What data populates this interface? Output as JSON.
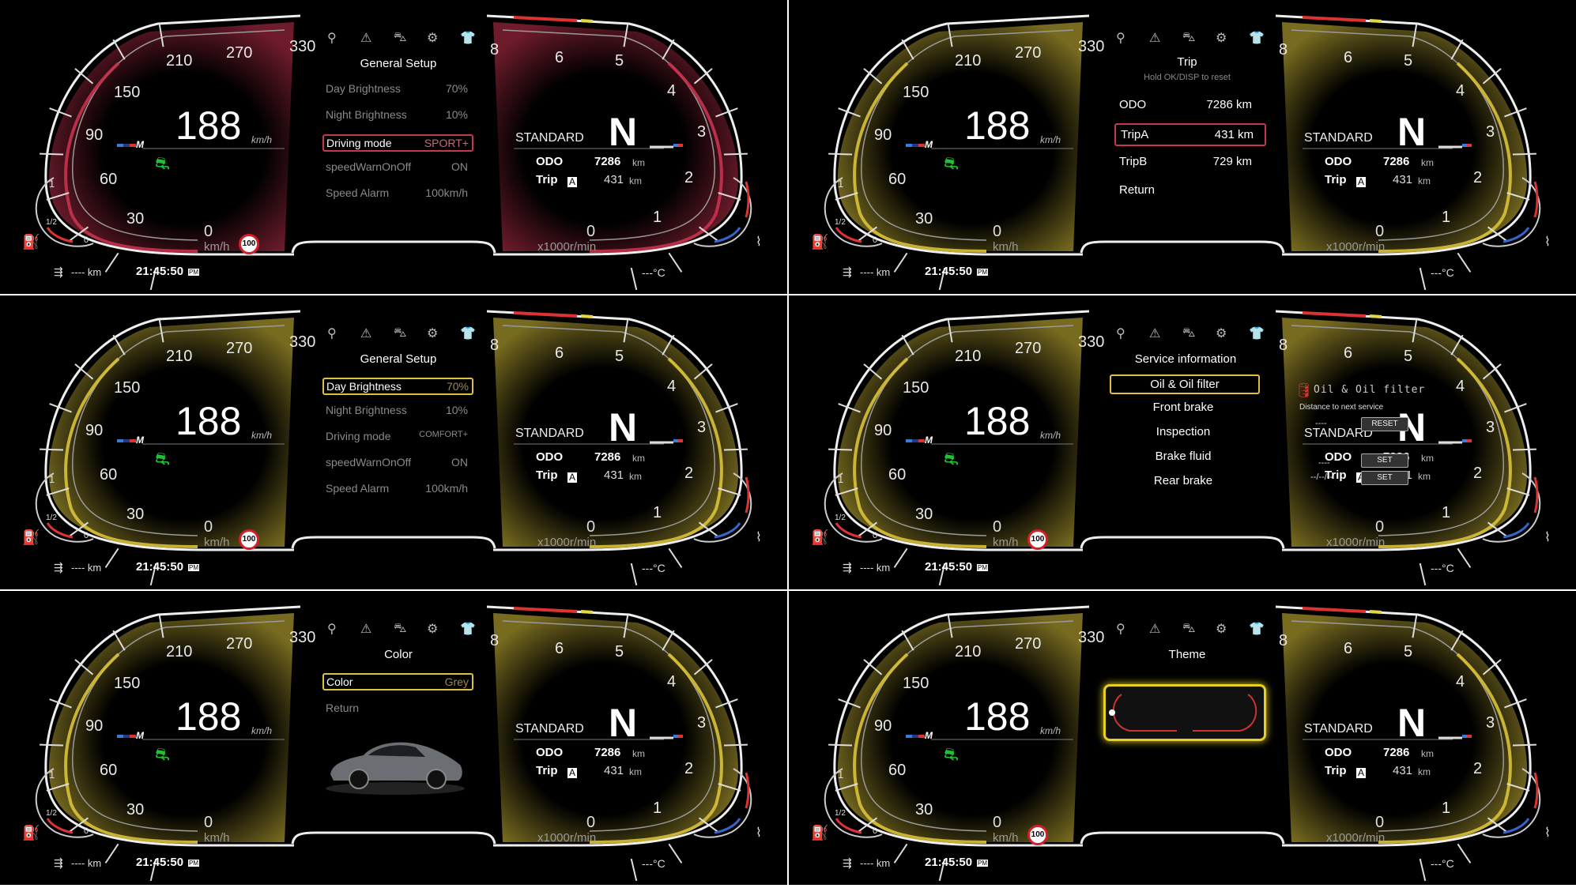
{
  "cluster": {
    "speed": "188",
    "speed_unit": "km/h",
    "speed_unit_bottom": "km/h",
    "speed_ticks": [
      "330",
      "270",
      "210",
      "150",
      "90",
      "60",
      "30",
      "0"
    ],
    "rpm_ticks": [
      "8",
      "6",
      "5",
      "4",
      "3",
      "2",
      "1",
      "0"
    ],
    "rpm_unit": "x1000r/min",
    "drive_mode": "STANDARD",
    "gear": "N",
    "odo_label": "ODO",
    "odo_value": "7286",
    "trip_label": "Trip",
    "trip_badge": "A",
    "trip_value": "431",
    "km": "km",
    "range": "---- km",
    "clock": "21:45:50",
    "clock_suffix": "PM",
    "outside_temp": "---°C",
    "speed_limit": "100",
    "fuel_one": "1",
    "fuel_half": "1/2",
    "fuel_zero": "0"
  },
  "panels": [
    {
      "theme": "red",
      "accent": "#c8324e",
      "show_limit_sign": true,
      "menu": {
        "title": "General Setup",
        "items": [
          {
            "label": "Day Brightness",
            "value": "70%",
            "selected": false
          },
          {
            "label": "Night Brightness",
            "value": "10%",
            "selected": false
          },
          {
            "label": "Driving mode",
            "value": "SPORT+",
            "selected": true
          },
          {
            "label": "speedWarnOnOff",
            "value": "ON",
            "selected": false
          },
          {
            "label": "Speed Alarm",
            "value": "100km/h",
            "selected": false
          }
        ]
      }
    },
    {
      "theme": "yellow",
      "accent": "#d9c23a",
      "show_limit_sign": false,
      "trip_menu": {
        "title": "Trip",
        "subtitle": "Hold OK/DISP to reset",
        "items": [
          {
            "label": "ODO",
            "value": "7286 km",
            "selected": false
          },
          {
            "label": "TripA",
            "value": "431 km",
            "selected": true
          },
          {
            "label": "TripB",
            "value": "729 km",
            "selected": false
          },
          {
            "label": "Return",
            "value": "",
            "selected": false
          }
        ]
      }
    },
    {
      "theme": "yellow",
      "accent": "#d9c23a",
      "show_limit_sign": true,
      "menu": {
        "title": "General Setup",
        "items": [
          {
            "label": "Day Brightness",
            "value": "70%",
            "selected": true
          },
          {
            "label": "Night Brightness",
            "value": "10%",
            "selected": false
          },
          {
            "label": "Driving mode",
            "value": "COMFORT+",
            "selected": false
          },
          {
            "label": "speedWarnOnOff",
            "value": "ON",
            "selected": false
          },
          {
            "label": "Speed Alarm",
            "value": "100km/h",
            "selected": false
          }
        ]
      }
    },
    {
      "theme": "yellow",
      "accent": "#d9c23a",
      "show_limit_sign": true,
      "service": {
        "title": "Service information",
        "items": [
          "Oil & Oil filter",
          "Front brake",
          "Inspection",
          "Brake fluid",
          "Rear brake"
        ],
        "selected_index": 0,
        "detail_title": "Oil & Oil filter",
        "distance_label": "Distance to next service",
        "distance_value": "----",
        "reset_label": "RESET",
        "value2": "----",
        "set_label": "SET",
        "date_value": "--/--/--",
        "set_label2": "SET"
      }
    },
    {
      "theme": "yellow",
      "accent": "#d9c23a",
      "show_limit_sign": false,
      "color_menu": {
        "title": "Color",
        "item_label": "Color",
        "item_value": "Grey",
        "return_label": "Return"
      }
    },
    {
      "theme": "yellow",
      "accent": "#d9c23a",
      "show_limit_sign": true,
      "theme_menu": {
        "title": "Theme"
      }
    }
  ],
  "top_icons": [
    "location-icon",
    "warning-icon",
    "car-icon",
    "gear-icon",
    "shirt-icon"
  ]
}
